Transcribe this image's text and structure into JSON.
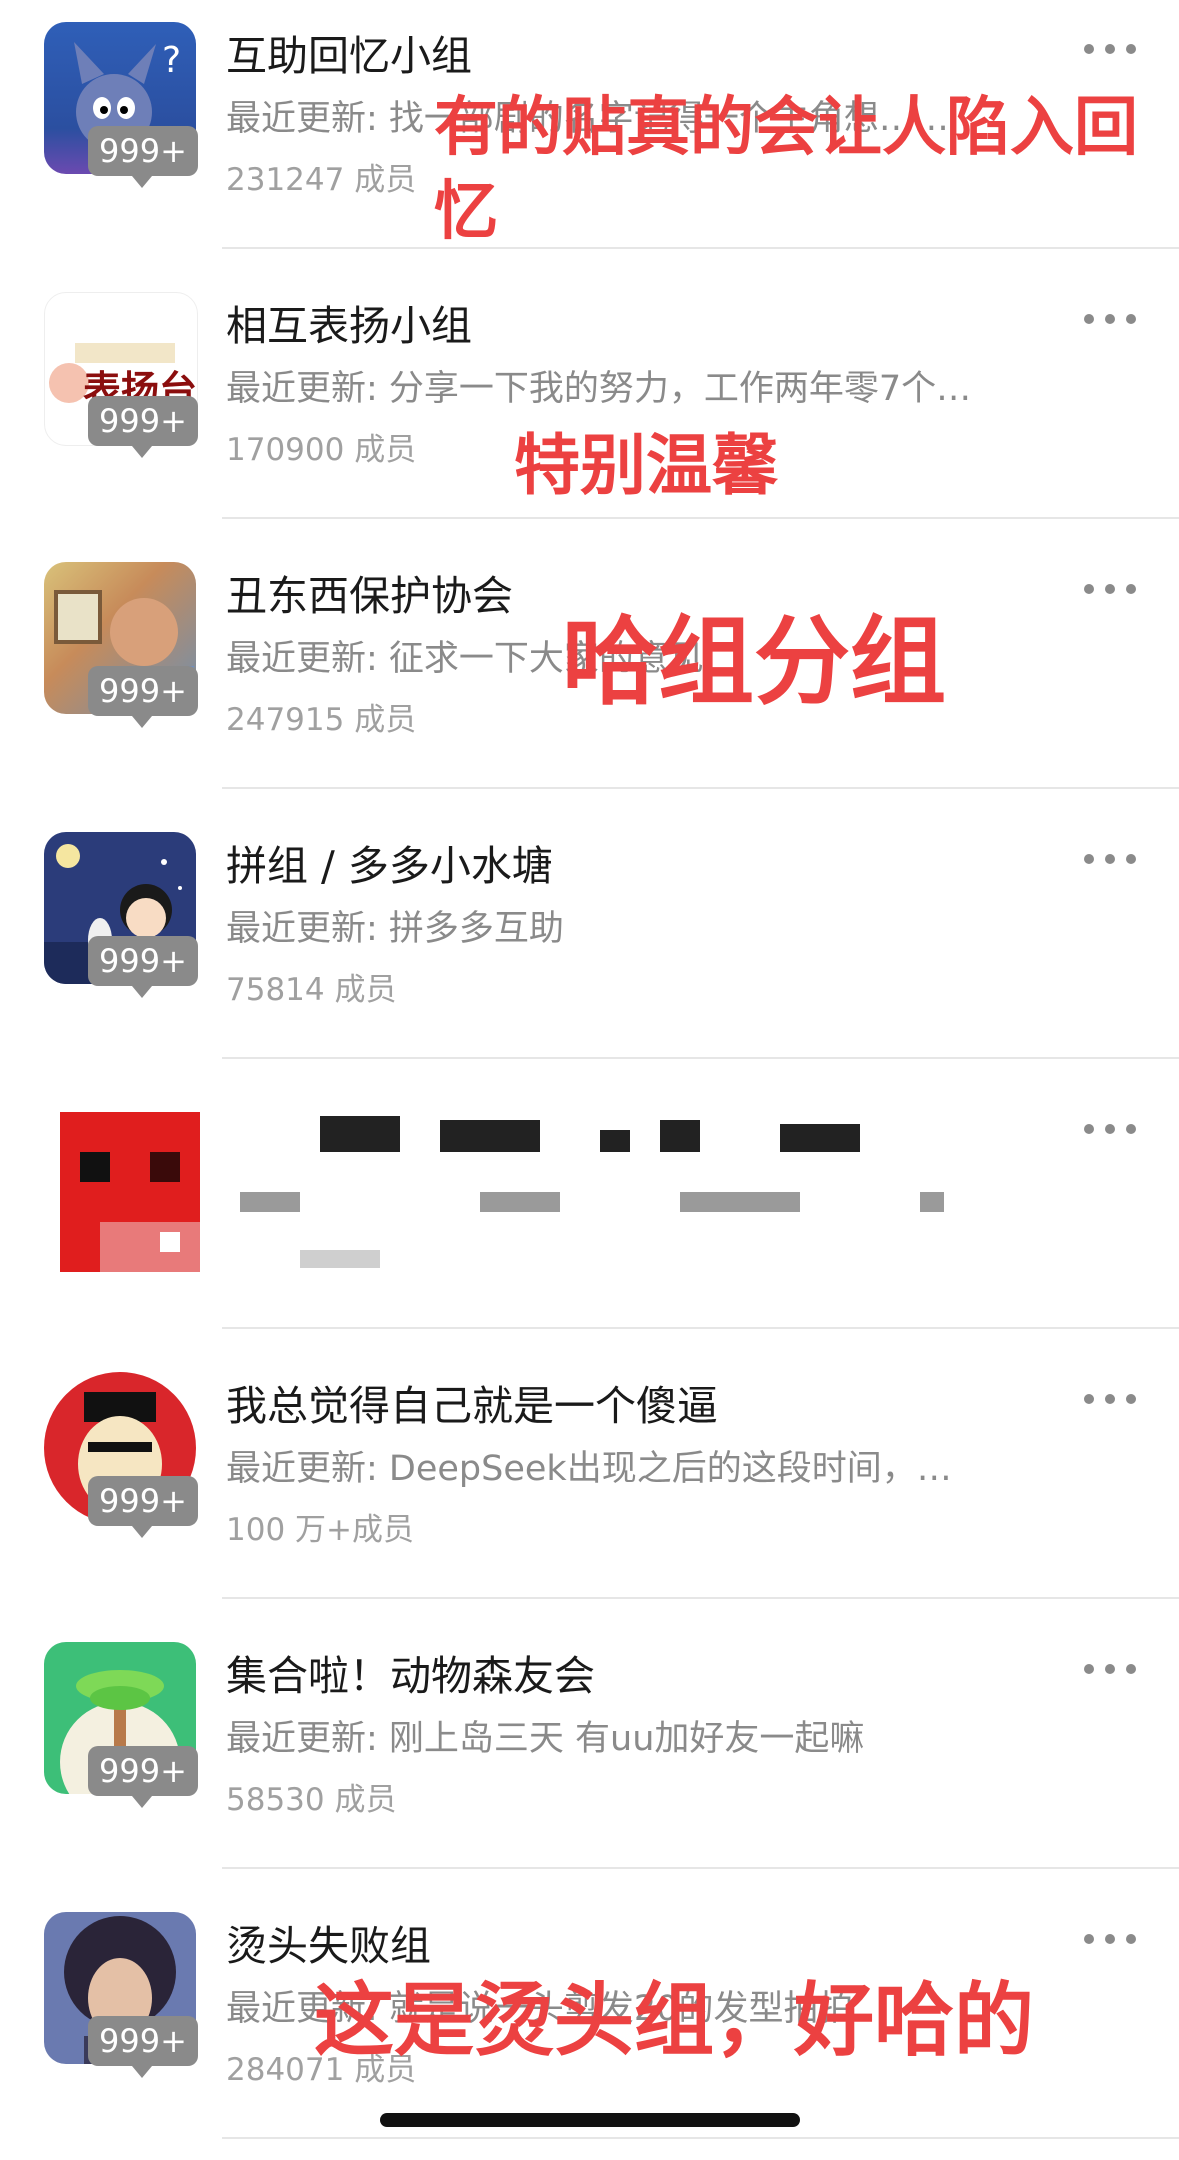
{
  "badge_text": "999+",
  "update_prefix": "最近更新: ",
  "colors": {
    "overlay_red": "#ec4141",
    "badge_gray": "#8a8a8a",
    "title": "#1a1a1a",
    "meta": "#8a8a8a"
  },
  "groups": [
    {
      "name": "互助回忆小组",
      "update": "最近更新: 找一部剧的名字记得一个主角想……",
      "members": "231247 成员",
      "avatar": "tom-cat-avatar"
    },
    {
      "name": "相互表扬小组",
      "update": "最近更新: 分享一下我的努力，工作两年零7个…",
      "members": "170900 成员",
      "avatar": "praise-stage-avatar"
    },
    {
      "name": "丑东西保护协会",
      "update": "最近更新: 征求一下大家的意见",
      "members": "247915 成员",
      "avatar": "man-portrait-avatar"
    },
    {
      "name": "拼组 / 多多小水塘",
      "update": "最近更新: 拼多多互助",
      "members": "75814 成员",
      "avatar": "maruko-night-avatar"
    },
    {
      "name": "",
      "update": "",
      "members": "",
      "avatar": "pixelated-avatar"
    },
    {
      "name": "我总觉得自己就是一个傻逼",
      "update": "最近更新: DeepSeek出现之后的这段时间，…",
      "members": "100 万+成员",
      "avatar": "cartoon-face-avatar"
    },
    {
      "name": "集合啦！动物森友会",
      "update": "最近更新: 刚上岛三天 有uu加好友一起嘛",
      "members": "58530 成员",
      "avatar": "palm-island-avatar"
    },
    {
      "name": "烫头失败组",
      "update": "最近更新: 就是说一头剪发20的发型拍拍",
      "members": "284071 成员",
      "avatar": "curly-hair-avatar"
    }
  ],
  "annotations": {
    "a1_line1": "有的贴真的会让人陷入回",
    "a1_line2": "忆",
    "a2": "特别温馨",
    "a3": "哈组分组",
    "a4": "这是烫头组，好哈的"
  }
}
